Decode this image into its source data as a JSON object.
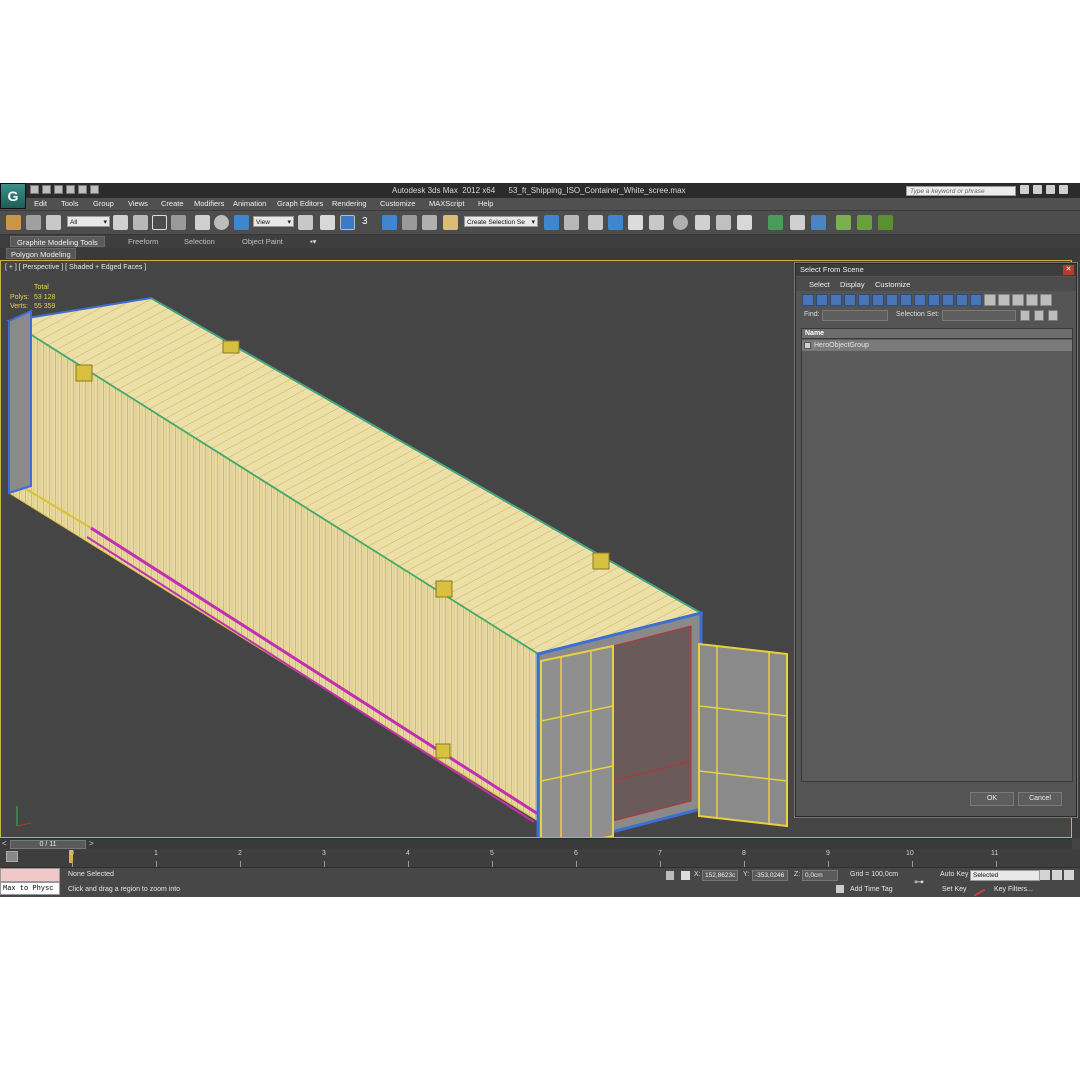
{
  "title_bar": {
    "app_title": "Autodesk 3ds Max  2012 x64",
    "file_name": "53_ft_Shipping_ISO_Container_White_scree.max",
    "search_placeholder": "Type a keyword or phrase"
  },
  "menu": [
    "Edit",
    "Tools",
    "Group",
    "Views",
    "Create",
    "Modifiers",
    "Animation",
    "Graph Editors",
    "Rendering",
    "Customize",
    "MAXScript",
    "Help"
  ],
  "toolbar": {
    "filter_dropdown": "All",
    "ref_coord_dropdown": "View",
    "snap_label": "3",
    "selection_set_dropdown": "Create Selection Se"
  },
  "ribbon": {
    "tabs": [
      "Graphite Modeling Tools",
      "Freeform",
      "Selection",
      "Object Paint"
    ],
    "sub_tab": "Polygon Modeling"
  },
  "viewport": {
    "label": "[ + ] [ Perspective ] [ Shaded + Edged Faces ]",
    "stats": {
      "total_label": "Total",
      "polys_label": "Polys:",
      "polys_value": "53 128",
      "verts_label": "Verts:",
      "verts_value": "55 359"
    }
  },
  "dialog": {
    "title": "Select From Scene",
    "menu": [
      "Select",
      "Display",
      "Customize"
    ],
    "find_label": "Find:",
    "selection_set_label": "Selection Set:",
    "column_header": "Name",
    "items": [
      "HeroObjectGroup"
    ],
    "ok_label": "OK",
    "cancel_label": "Cancel"
  },
  "time_slider": {
    "position_text": "0 / 11",
    "prev_arrow": "<",
    "next_arrow": ">"
  },
  "trackbar": {
    "ticks": [
      "0",
      "1",
      "2",
      "3",
      "4",
      "5",
      "6",
      "7",
      "8",
      "9",
      "10",
      "11"
    ]
  },
  "status": {
    "maxscript_listener": "Max to Physc",
    "selection_status": "None Selected",
    "prompt": "Click and drag a region to zoom into",
    "x_label": "X:",
    "x_value": "152,8623c",
    "y_label": "Y:",
    "y_value": "-353,0246",
    "z_label": "Z:",
    "z_value": "0,0cm",
    "grid": "Grid = 100,0cm",
    "add_time_tag": "Add Time Tag",
    "auto_key": "Auto Key",
    "selected_dropdown": "Selected",
    "set_key": "Set Key",
    "key_filters": "Key Filters..."
  },
  "colors": {
    "container_fill": "#e8d9a0",
    "container_wire": "#d8c040",
    "edge_blue": "#3b6fd4",
    "edge_magenta": "#c030b0",
    "edge_green": "#40b060",
    "interior_fill": "#8a8a8a"
  }
}
